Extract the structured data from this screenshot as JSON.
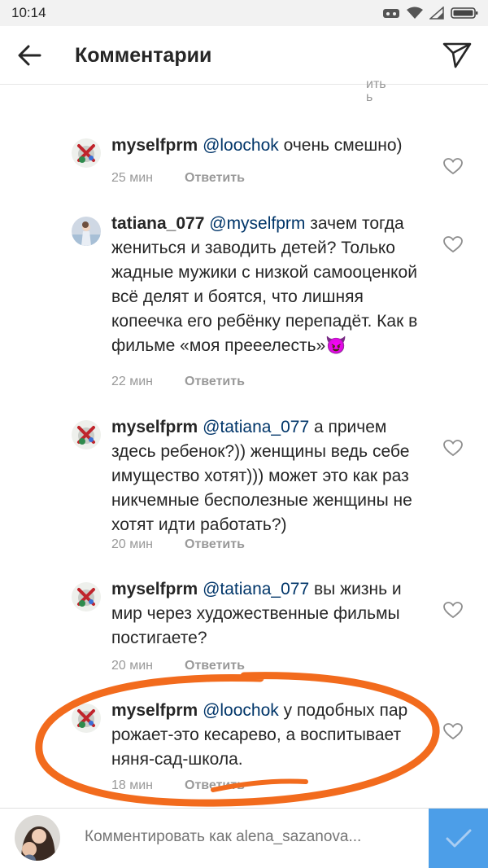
{
  "status": {
    "time": "10:14"
  },
  "header": {
    "title": "Комментарии"
  },
  "cut_text": "ить\nь",
  "comments": [
    {
      "user": "myselfprm",
      "mention": "@loochok",
      "text": " очень смешно)",
      "time": "25 мин",
      "reply": "Ответить"
    },
    {
      "user": "tatiana_077",
      "mention": "@myselfprm",
      "text": " зачем тогда жениться и заводить детей? Только жадные мужики с низкой самооценкой всё делят и боятся, что лишняя копеечка его ребёнку перепадёт. Как в фильме «моя прееелесть»😈",
      "time": "22 мин",
      "reply": "Ответить"
    },
    {
      "user": "myselfprm",
      "mention": "@tatiana_077",
      "text": " а причем здесь ребенок?)) женщины ведь себе имущество хотят))) может это как раз никчемные бесполезные женщины не хотят идти работать?)",
      "time": "20 мин",
      "reply": "Ответить"
    },
    {
      "user": "myselfprm",
      "mention": "@tatiana_077",
      "text": " вы жизнь и мир через художественные фильмы постигаете?",
      "time": "20 мин",
      "reply": "Ответить"
    },
    {
      "user": "myselfprm",
      "mention": "@loochok",
      "text": " у подобных пар рожает-это кесарево, а воспитывает няня-сад-школа.",
      "time": "18 мин",
      "reply": "Ответить"
    }
  ],
  "input": {
    "placeholder": "Комментировать как alena_sazanova..."
  },
  "colors": {
    "mention": "#003569",
    "accent": "#4c9ee8",
    "highlight": "#f26b1d"
  }
}
